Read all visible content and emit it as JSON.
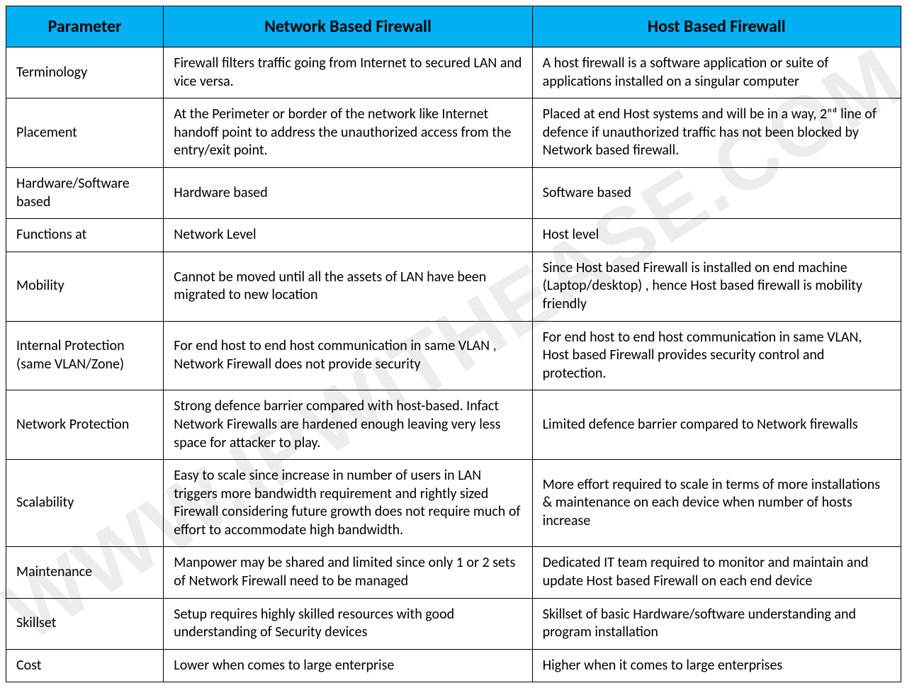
{
  "watermark": "WWW.IPWITHEASE.COM",
  "headers": {
    "param": "Parameter",
    "net": "Network Based Firewall",
    "host": "Host Based Firewall"
  },
  "rows": [
    {
      "param": "Terminology",
      "net": "Firewall filters traffic going from Internet to secured LAN and vice versa.",
      "host": "A host firewall is a software application or suite of applications installed on a singular computer"
    },
    {
      "param": "Placement",
      "net": "At the Perimeter or border of the network like Internet handoff point to address the unauthorized access from the entry/exit point.",
      "host": "Placed at end Host systems and will be in a way, 2ⁿᵈ line of defence if unauthorized traffic has not been blocked by Network based firewall."
    },
    {
      "param": "Hardware/Software based",
      "net": "Hardware based",
      "host": "Software based"
    },
    {
      "param": "Functions at",
      "net": "Network Level",
      "host": "Host level"
    },
    {
      "param": "Mobility",
      "net": "Cannot be moved until all the assets of LAN have been migrated to new location",
      "host": "Since Host based Firewall is installed on end machine (Laptop/desktop) , hence Host based firewall is mobility friendly"
    },
    {
      "param": "Internal Protection (same VLAN/Zone)",
      "net": "For end host to end host communication in same VLAN , Network Firewall does not provide security",
      "host": "For end host to end host communication in same VLAN, Host based Firewall provides security control and protection."
    },
    {
      "param": "Network Protection",
      "net": "Strong defence barrier compared with host-based. Infact Network Firewalls are hardened enough leaving very less space for attacker to play.",
      "host": "Limited defence barrier compared to Network firewalls"
    },
    {
      "param": "Scalability",
      "net": "Easy to scale since increase in number of users in LAN triggers more bandwidth requirement and rightly sized Firewall considering future growth does not require much of effort to accommodate high bandwidth.",
      "host": "More effort required to scale in terms of more installations & maintenance on each device when number of hosts increase"
    },
    {
      "param": "Maintenance",
      "net": "Manpower may be shared and limited since only 1 or 2 sets of Network Firewall need to be managed",
      "host": "Dedicated IT team required to monitor and maintain and update Host based Firewall on each end device"
    },
    {
      "param": "Skillset",
      "net": "Setup requires highly skilled resources with good understanding of Security devices",
      "host": "Skillset of basic Hardware/software understanding and program installation"
    },
    {
      "param": "Cost",
      "net": "Lower when comes to large enterprise",
      "host": "Higher when it comes to large enterprises"
    }
  ]
}
